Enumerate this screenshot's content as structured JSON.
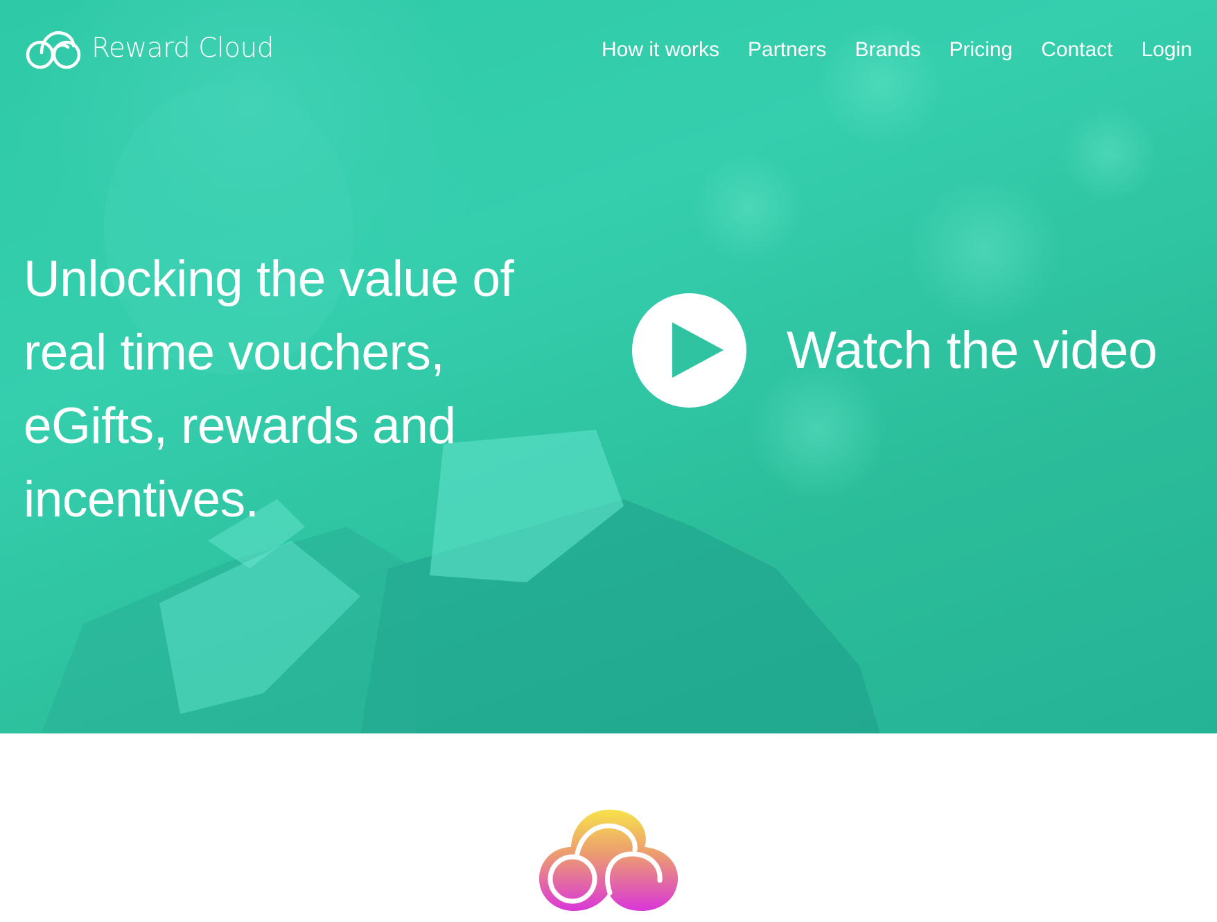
{
  "brand": {
    "name": "Reward Cloud",
    "logo_icon": "cloud-logo-icon"
  },
  "nav": {
    "items": [
      {
        "label": "How it works"
      },
      {
        "label": "Partners"
      },
      {
        "label": "Brands"
      },
      {
        "label": "Pricing"
      },
      {
        "label": "Contact"
      },
      {
        "label": "Login"
      }
    ]
  },
  "hero": {
    "headline": "Unlocking the value of real time vouchers, eGifts, rewards and incentives.",
    "video_label": "Watch the video",
    "play_icon": "play-icon",
    "overlay_color": "#2ec9a6"
  },
  "colors": {
    "hero_teal": "#2ec9a6",
    "brand_gradient_top": "#f7e24a",
    "brand_gradient_bottom": "#d936d9"
  }
}
